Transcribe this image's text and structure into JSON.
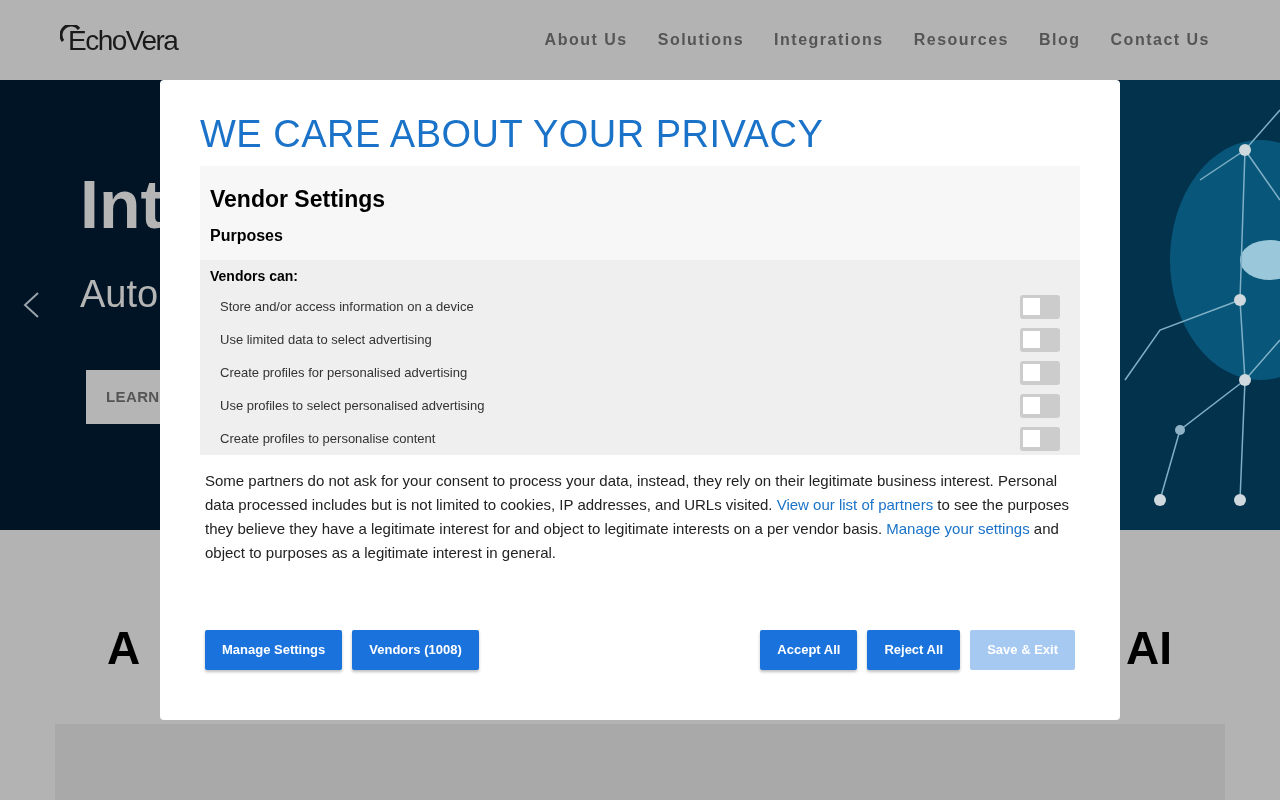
{
  "header": {
    "logo": "EchoVera",
    "nav": [
      {
        "label": "About Us"
      },
      {
        "label": "Solutions"
      },
      {
        "label": "Integrations"
      },
      {
        "label": "Resources"
      },
      {
        "label": "Blog"
      },
      {
        "label": "Contact Us"
      }
    ]
  },
  "hero": {
    "title": "Int",
    "subtitle": "Auto",
    "button": "LEARN"
  },
  "section": {
    "heading_left": "A",
    "heading_right": "AI"
  },
  "dialog": {
    "title": "WE CARE ABOUT YOUR PRIVACY",
    "settings": {
      "title": "Vendor Settings",
      "subtitle": "Purposes",
      "group": "Vendors can:",
      "purposes": [
        {
          "label": "Store and/or access information on a device",
          "on": false
        },
        {
          "label": "Use limited data to select advertising",
          "on": false
        },
        {
          "label": "Create profiles for personalised advertising",
          "on": false
        },
        {
          "label": "Use profiles to select personalised advertising",
          "on": false
        },
        {
          "label": "Create profiles to personalise content",
          "on": false
        }
      ]
    },
    "paragraph": [
      {
        "kind": "text",
        "text": "Some partners do not ask for your consent to process your data, instead, they rely on their legitimate business interest. Personal data processed includes but is not limited to cookies, IP addresses, and URLs visited. "
      },
      {
        "kind": "link",
        "text": "View our list of partners"
      },
      {
        "kind": "text",
        "text": " to see the purposes they believe they have a legitimate interest for and object to legitimate interests on a per vendor basis. "
      },
      {
        "kind": "link",
        "text": "Manage your settings"
      },
      {
        "kind": "text",
        "text": " and object to purposes as a legitimate interest in general."
      }
    ],
    "buttons_left": [
      {
        "label": "Manage Settings",
        "disabled": false
      },
      {
        "label": "Vendors (1008)",
        "disabled": false
      }
    ],
    "buttons_right": [
      {
        "label": "Accept All",
        "disabled": false
      },
      {
        "label": "Reject All",
        "disabled": false
      },
      {
        "label": "Save & Exit",
        "disabled": true
      }
    ]
  }
}
